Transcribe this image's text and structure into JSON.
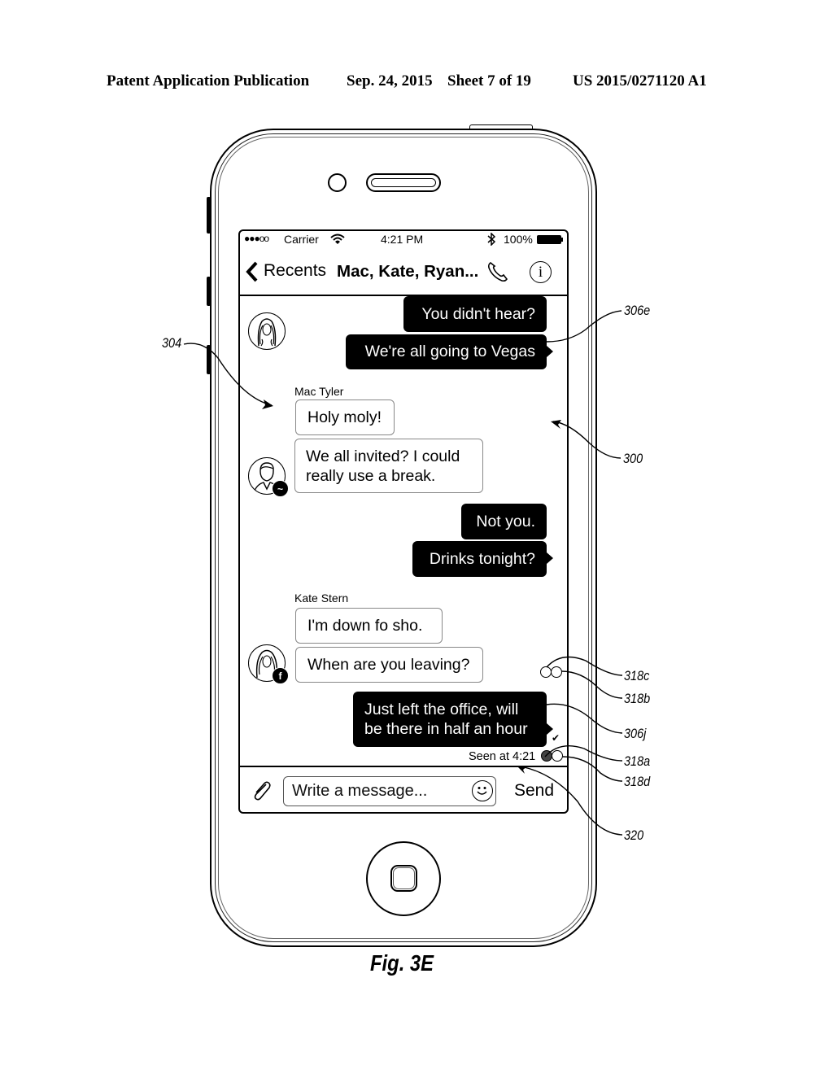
{
  "patent_header": {
    "publication": "Patent Application Publication",
    "date": "Sep. 24, 2015",
    "sheet": "Sheet 7 of 19",
    "number": "US 2015/0271120 A1"
  },
  "status_bar": {
    "signal": "●●●oo",
    "carrier": "Carrier",
    "wifi_icon": "wifi-icon",
    "time": "4:21 PM",
    "bluetooth_icon": "bluetooth-icon",
    "battery": "100%"
  },
  "nav_bar": {
    "back_label": "Recents",
    "title": "Mac, Kate, Ryan...",
    "call_icon": "phone-icon",
    "info_icon": "info-icon"
  },
  "messages": [
    {
      "side": "right",
      "text": "You didn't hear?"
    },
    {
      "side": "right",
      "text": "We're all going to Vegas"
    },
    {
      "side": "left",
      "sender": "Mac Tyler",
      "text": "Holy moly!"
    },
    {
      "side": "left",
      "text_line1": "We all invited? I could",
      "text_line2": "really use a break."
    },
    {
      "side": "right",
      "text": "Not you."
    },
    {
      "side": "right",
      "text": "Drinks tonight?"
    },
    {
      "side": "left",
      "sender": "Kate Stern",
      "text": "I'm down fo sho."
    },
    {
      "side": "left",
      "text": "When are you leaving?"
    },
    {
      "side": "right",
      "text_line1": "Just left the office, will",
      "text_line2": "be there in half an hour"
    }
  ],
  "read_status": {
    "seen_text": "Seen at 4:21",
    "checkmark": "✔"
  },
  "composer": {
    "attach_icon": "paperclip-icon",
    "placeholder": "Write a message...",
    "emoji_icon": "smiley-icon",
    "send_label": "Send"
  },
  "reference_labels": {
    "l304": "304",
    "l306e": "306e",
    "l300": "300",
    "l318c": "318c",
    "l318b": "318b",
    "l306j": "306j",
    "l318a": "318a",
    "l318d": "318d",
    "l320": "320"
  },
  "figure_caption": "Fig. 3E"
}
